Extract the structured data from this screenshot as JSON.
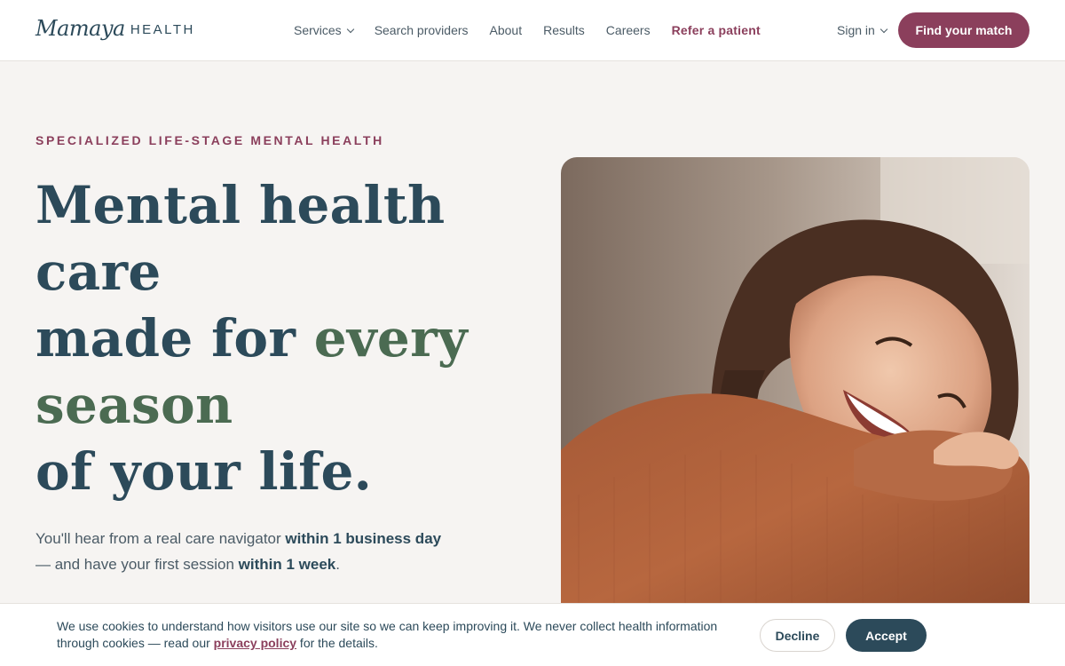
{
  "header": {
    "logo": {
      "script": "Mamaya",
      "word": "HEALTH"
    },
    "nav": [
      {
        "label": "Services",
        "has_dropdown": true
      },
      {
        "label": "Search providers"
      },
      {
        "label": "About"
      },
      {
        "label": "Results"
      },
      {
        "label": "Careers"
      },
      {
        "label": "Refer a patient",
        "accent": true
      }
    ],
    "sign_in": "Sign in",
    "cta": "Find your match"
  },
  "hero": {
    "eyebrow": "SPECIALIZED LIFE-STAGE MENTAL HEALTH",
    "headline": {
      "line1": "Mental health",
      "line2": "care",
      "line3_start": "made for ",
      "line3_accent": "every",
      "line4_accent": "season",
      "line5": "of your life."
    },
    "subtext": {
      "p1": "You'll hear from a real care navigator ",
      "b1": "within 1 business day",
      "p2": " — and have your first session ",
      "b2": "within 1 week",
      "p3": "."
    }
  },
  "cookie": {
    "text_before": "We use cookies to understand how visitors use our site so we can keep improving it. We never collect health information through cookies — read our ",
    "link": "privacy policy",
    "text_after": " for the details.",
    "decline": "Decline",
    "accept": "Accept"
  },
  "colors": {
    "brand_plum": "#8b3f5c",
    "brand_navy": "#2c4a5a",
    "accent_green": "#4b6b52",
    "background": "#f6f4f2"
  }
}
